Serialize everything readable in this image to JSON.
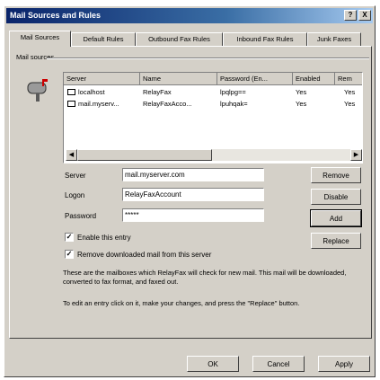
{
  "window": {
    "title": "Mail Sources and Rules",
    "help_label": "?",
    "close_label": "X"
  },
  "tabs": [
    {
      "label": "Mail Sources",
      "active": true
    },
    {
      "label": "Default Rules",
      "active": false
    },
    {
      "label": "Outbound Fax Rules",
      "active": false
    },
    {
      "label": "Inbound Fax Rules",
      "active": false
    },
    {
      "label": "Junk Faxes",
      "active": false
    }
  ],
  "group_label": "Mail sources",
  "list": {
    "columns": [
      "Server",
      "Name",
      "Password (En...",
      "Enabled",
      "Rem"
    ],
    "rows": [
      {
        "server": "localhost",
        "name": "RelayFax",
        "password": "lpqlpg==",
        "enabled": "Yes",
        "rem": "Yes",
        "icon": "envelope-icon"
      },
      {
        "server": "mail.myserv...",
        "name": "RelayFaxAcco...",
        "password": "lpuhqak=",
        "enabled": "Yes",
        "rem": "Yes",
        "icon": "envelope-icon"
      }
    ]
  },
  "scrollbar": {
    "left_arrow": "◀",
    "right_arrow": "▶"
  },
  "form": {
    "server_label": "Server",
    "server_value": "mail.myserver.com",
    "logon_label": "Logon",
    "logon_value": "RelayFaxAccount",
    "password_label": "Password",
    "password_value": "*****"
  },
  "side_buttons": {
    "remove": "Remove",
    "disable": "Disable",
    "add": "Add",
    "replace": "Replace"
  },
  "checkboxes": {
    "enable_label": "Enable this entry",
    "enable_checked": true,
    "remove_label": "Remove downloaded mail from this server",
    "remove_checked": true,
    "check_mark": "✓"
  },
  "info": {
    "line1": "These are the mailboxes which RelayFax will check for new mail. This mail will be downloaded, converted to fax format, and faxed out.",
    "line2": "To edit an entry click on it, make your changes, and press the \"Replace\" button."
  },
  "footer": {
    "ok": "OK",
    "cancel": "Cancel",
    "apply": "Apply"
  },
  "colors": {
    "titlebar_start": "#0a246a",
    "titlebar_end": "#a6caf0",
    "face": "#d4d0c8"
  }
}
